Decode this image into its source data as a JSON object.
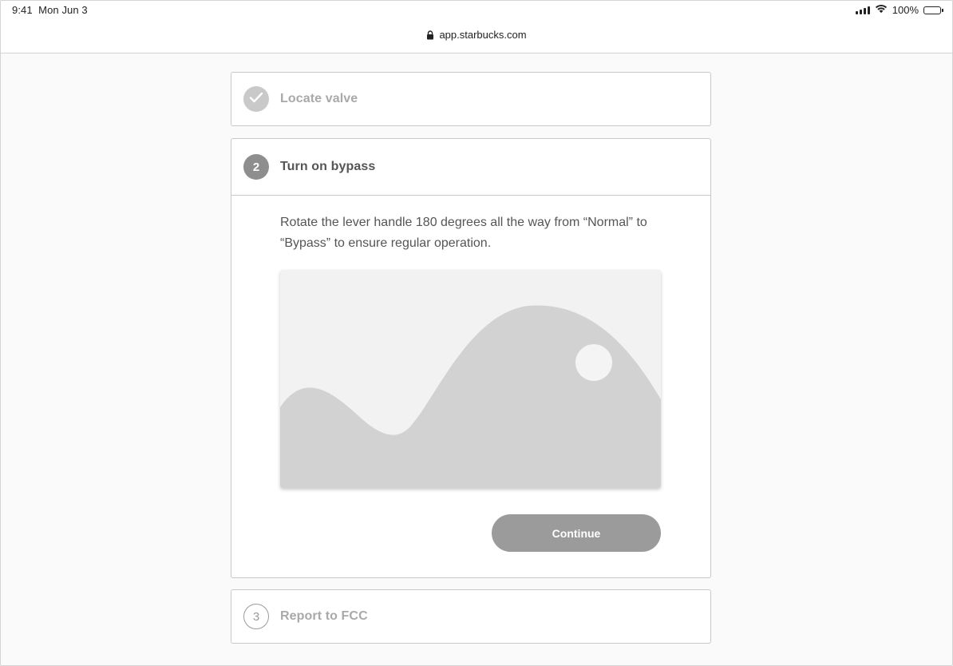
{
  "status_bar": {
    "time": "9:41",
    "date": "Mon Jun 3",
    "battery": "100%",
    "icons": [
      "signal-icon",
      "wifi-icon",
      "battery-icon"
    ]
  },
  "browser": {
    "url": "app.starbucks.com",
    "icon": "lock-icon"
  },
  "steps": [
    {
      "number": "1",
      "title": "Locate valve",
      "state": "completed",
      "icon": "checkmark-icon"
    },
    {
      "number": "2",
      "title": "Turn on bypass",
      "state": "active",
      "instruction": "Rotate the lever handle 180 degrees all the way from “Normal” to “Bypass” to ensure regular operation.",
      "image": "image-placeholder",
      "continue_label": "Continue"
    },
    {
      "number": "3",
      "title": "Report to FCC",
      "state": "pending"
    }
  ],
  "colors": {
    "active_circle": "#8e8e8e",
    "done_circle": "#c9c9c9",
    "button": "#9b9b9b",
    "border": "#c8c8c8"
  }
}
